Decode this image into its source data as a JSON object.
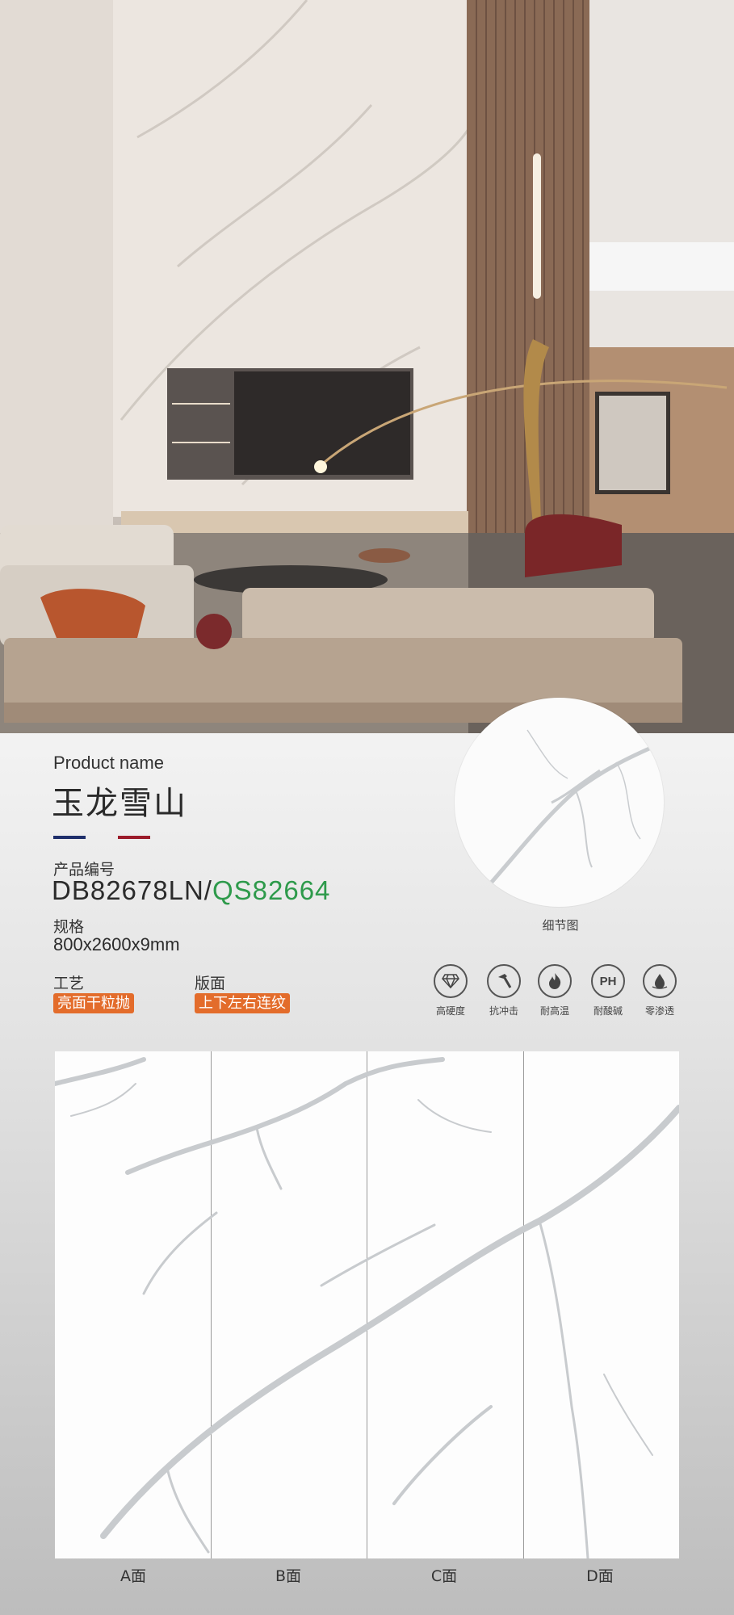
{
  "product": {
    "label_en": "Product name",
    "name_cn": "玉龙雪山",
    "code_label": "产品编号",
    "code_primary": "DB82678LN/",
    "code_secondary": "QS82664",
    "spec_label": "规格",
    "spec_value": "800x2600x9mm",
    "craft_label": "工艺",
    "craft_value": "亮面干粒抛",
    "layout_label": "版面",
    "layout_value": "上下左右连纹"
  },
  "detail": {
    "caption": "细节图"
  },
  "features": [
    {
      "label": "高硬度",
      "icon": "diamond-icon"
    },
    {
      "label": "抗冲击",
      "icon": "hammer-icon"
    },
    {
      "label": "耐高温",
      "icon": "flame-icon"
    },
    {
      "label": "耐酸碱",
      "icon": "ph-icon",
      "glyph": "PH"
    },
    {
      "label": "零渗透",
      "icon": "drop-icon"
    }
  ],
  "slabs": [
    "A面",
    "B面",
    "C面",
    "D面"
  ],
  "colors": {
    "accent_orange": "#e36c2b",
    "code_green": "#2e9a4b",
    "flag_blue": "#1f2f6b",
    "flag_red": "#9b1b2a"
  }
}
